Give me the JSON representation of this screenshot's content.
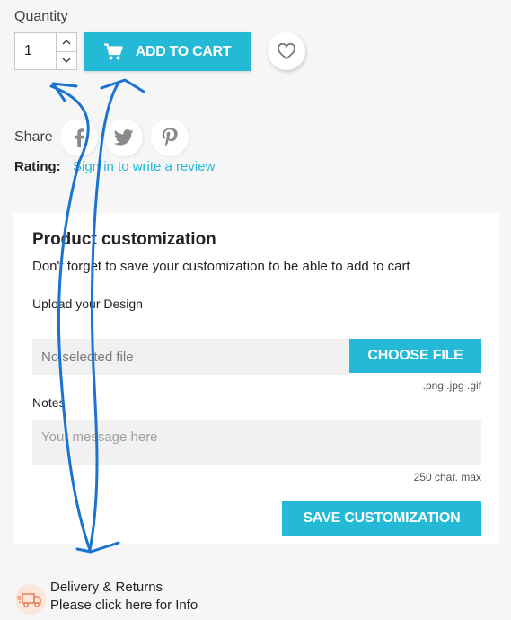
{
  "quantity": {
    "label": "Quantity",
    "value": "1",
    "up_glyph": "˄",
    "down_glyph": "˅"
  },
  "add_to_cart": {
    "label": "ADD TO CART",
    "icon": "cart-icon"
  },
  "wishlist": {
    "icon": "heart-icon"
  },
  "share": {
    "label": "Share",
    "networks": [
      "facebook-icon",
      "twitter-icon",
      "pinterest-icon"
    ]
  },
  "rating": {
    "label": "Rating:",
    "link": "Sign in to write a review"
  },
  "customization": {
    "title": "Product customization",
    "description": "Don't forget to save your customization to be able to add to cart",
    "upload_label": "Upload your Design",
    "file_placeholder": "No selected file",
    "choose_file": "CHOOSE FILE",
    "file_types": ".png .jpg .gif",
    "notes_label": "Notes",
    "notes_placeholder": "Your message here",
    "char_max": "250 char. max",
    "save_button": "SAVE CUSTOMIZATION"
  },
  "delivery": {
    "title": "Delivery & Returns",
    "subtitle": "Please click here for Info",
    "icon": "delivery-truck-icon"
  },
  "colors": {
    "accent": "#24b9d7",
    "background": "#f6f6f6",
    "annotation": "#1a73d1"
  }
}
